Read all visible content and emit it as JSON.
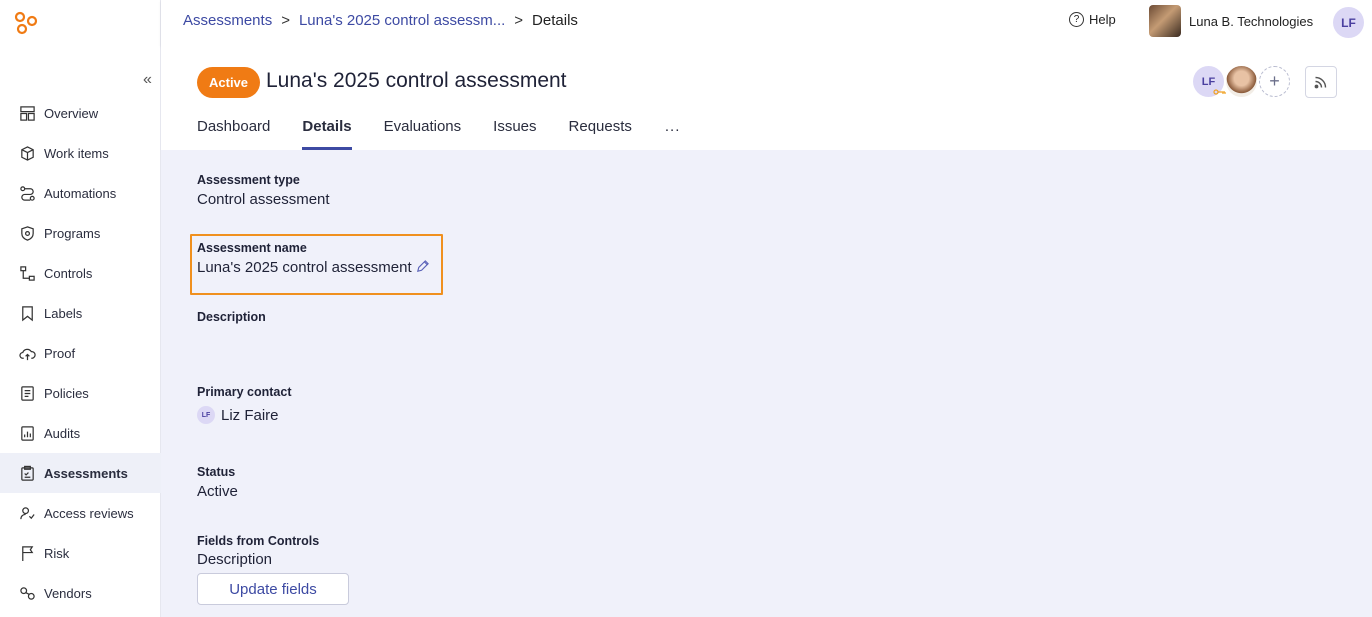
{
  "breadcrumb": {
    "root": "Assessments",
    "parent": "Luna's 2025 control assessm...",
    "current": "Details",
    "separator": ">"
  },
  "topbar": {
    "help_label": "Help",
    "org_name": "Luna B. Technologies",
    "user_initials": "LF"
  },
  "sidebar": {
    "items": [
      {
        "label": "Overview",
        "icon": "grid-icon"
      },
      {
        "label": "Work items",
        "icon": "box-icon"
      },
      {
        "label": "Automations",
        "icon": "flow-icon"
      },
      {
        "label": "Programs",
        "icon": "shield-icon"
      },
      {
        "label": "Controls",
        "icon": "hierarchy-icon"
      },
      {
        "label": "Labels",
        "icon": "bookmark-icon"
      },
      {
        "label": "Proof",
        "icon": "cloud-upload-icon"
      },
      {
        "label": "Policies",
        "icon": "policy-doc-icon"
      },
      {
        "label": "Audits",
        "icon": "audit-icon"
      },
      {
        "label": "Assessments",
        "icon": "clipboard-icon"
      },
      {
        "label": "Access reviews",
        "icon": "access-review-icon"
      },
      {
        "label": "Risk",
        "icon": "flag-icon"
      },
      {
        "label": "Vendors",
        "icon": "link-icon"
      }
    ],
    "active": "Assessments"
  },
  "header": {
    "status_badge": "Active",
    "title": "Luna's 2025 control assessment",
    "members": [
      "LF"
    ],
    "add_symbol": "+"
  },
  "tabs": [
    "Dashboard",
    "Details",
    "Evaluations",
    "Issues",
    "Requests",
    "..."
  ],
  "active_tab": "Details",
  "details": {
    "assessment_type_label": "Assessment type",
    "assessment_type_value": "Control assessment",
    "assessment_name_label": "Assessment name",
    "assessment_name_value": "Luna's 2025 control assessment",
    "description_label": "Description",
    "primary_contact_label": "Primary contact",
    "primary_contact_initials": "LF",
    "primary_contact_name": "Liz Faire",
    "status_label": "Status",
    "status_value": "Active",
    "fields_from_controls_label": "Fields from Controls",
    "fields_from_controls_value": "Description",
    "update_fields_button": "Update fields"
  },
  "colors": {
    "accent": "#3d4aa3",
    "badge": "#f07b14",
    "highlight": "#f0901e",
    "background": "#f0f1fa"
  }
}
